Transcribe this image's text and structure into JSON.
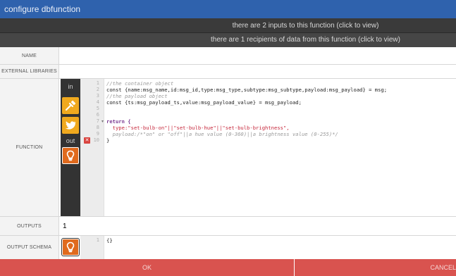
{
  "window": {
    "title": "configure dbfunction"
  },
  "inputs_bar": {
    "text": "there are 2 inputs to this function (click to view)"
  },
  "recipients_bar": {
    "text": "there are 1 recipients of data from this function (click to view)"
  },
  "fields": {
    "name": {
      "label": "NAME",
      "value": ""
    },
    "external_libraries": {
      "label": "EXTERNAL LIBRARIES",
      "value": ""
    },
    "function": {
      "label": "FUNCTION"
    },
    "outputs": {
      "label": "OUTPUTS",
      "value": "1"
    },
    "output_schema": {
      "label": "OUTPUT SCHEMA"
    }
  },
  "ports": {
    "in_label": "in",
    "out_label": "out",
    "inputs": [
      {
        "name": "philips-hue-icon",
        "color": "#f0a91e"
      },
      {
        "name": "twitter-icon",
        "color": "#f0a91e"
      }
    ],
    "output": {
      "name": "light-bulb-icon",
      "color": "#e06a1d"
    }
  },
  "editor": {
    "line_numbers": [
      "1",
      "2",
      "3",
      "4",
      "5",
      "6",
      "7",
      "8",
      "9",
      "10"
    ],
    "lines": [
      "//the container object",
      "const {name:msg_name,id:msg_id,type:msg_type,subtype:msg_subtype,payload:msg_payload} = msg;",
      "//the payload object",
      "const {ts:msg_payload_ts,value:msg_payload_value} = msg_payload;",
      "",
      "",
      "return {",
      "  type:\"set-bulb-on\"||\"set-bulb-hue\"||\"set-bulb-brightness\",",
      "  payload:/*\"on\" or \"off\"||a hue value (0-360)||a brightness value (0-255)*/",
      "}"
    ],
    "error_marker_line": "10"
  },
  "schema_editor": {
    "line_numbers": [
      "1"
    ],
    "lines": [
      "{}"
    ]
  },
  "footer": {
    "ok_label": "OK",
    "cancel_label": "CANCEL"
  }
}
